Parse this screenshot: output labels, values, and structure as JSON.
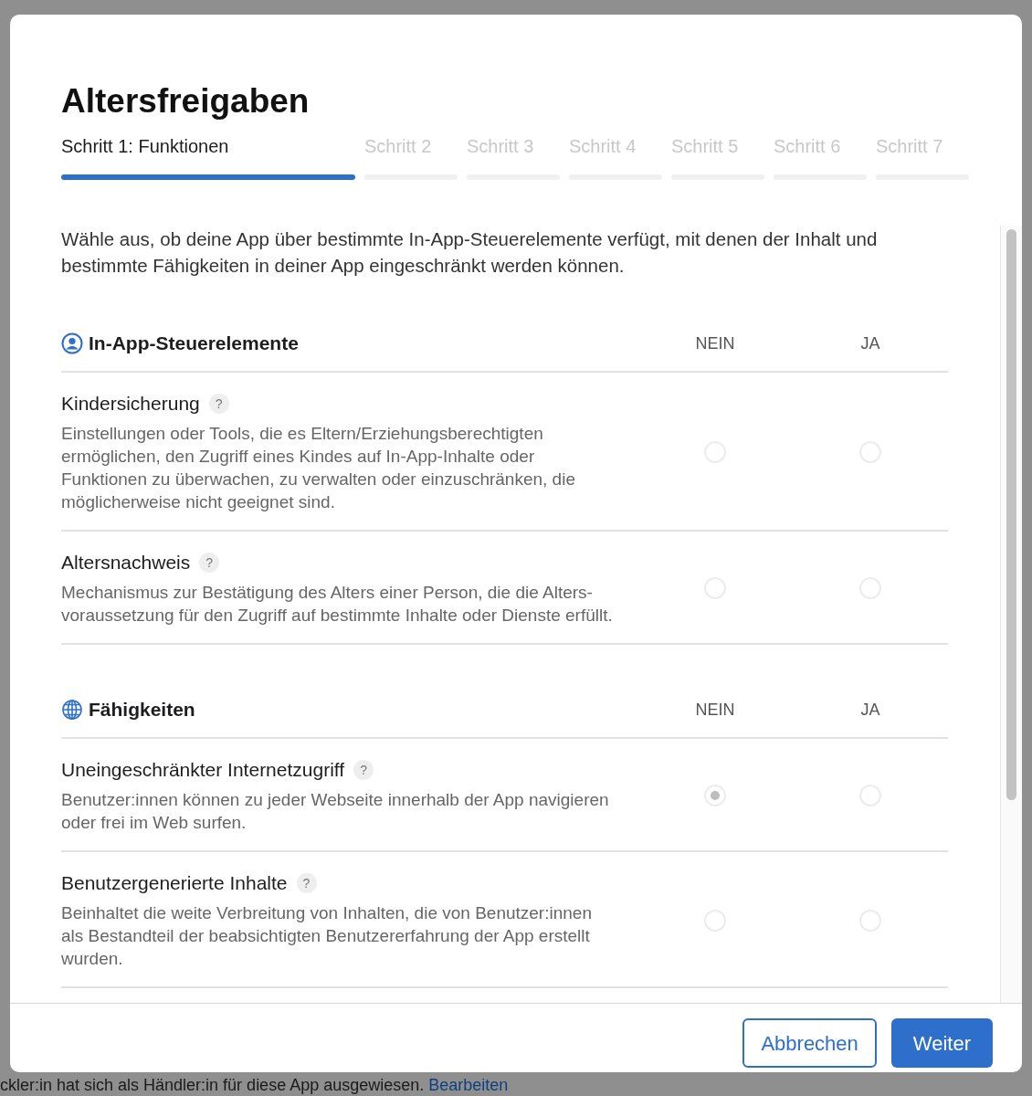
{
  "background": {
    "text": "ckler:in hat sich als Händler:in für diese App ausgewiesen.",
    "link": "Bearbeiten"
  },
  "dialog": {
    "title": "Altersfreigaben",
    "steps": [
      {
        "label": "Schritt 1: Funktionen",
        "selected": true
      },
      {
        "label": "Schritt 2",
        "selected": false
      },
      {
        "label": "Schritt 3",
        "selected": false
      },
      {
        "label": "Schritt 4",
        "selected": false
      },
      {
        "label": "Schritt 5",
        "selected": false
      },
      {
        "label": "Schritt 6",
        "selected": false
      },
      {
        "label": "Schritt 7",
        "selected": false
      }
    ],
    "intro": "Wähle aus, ob deine App über bestimmte In-App-Steuerelemente verfügt, mit denen der Inhalt und bestimmte Fähigkeiten in deiner App eingeschränkt werden können.",
    "sections": [
      {
        "kind": "person",
        "title": "In-App-Steuerelemente",
        "columns": [
          "NEIN",
          "JA"
        ],
        "rows": [
          {
            "title": "Kindersicherung",
            "help": "?",
            "description": "Einstellungen oder Tools, die es Eltern/Erziehungsberechtigten ermöglichen, den Zugriff eines Kindes auf In-App-Inhalte oder Funktionen zu überwachen, zu verwalten oder einzuschränken, die möglicherweise nicht geeignet sind.",
            "choices": [
              {
                "selected": false
              },
              {
                "selected": false
              }
            ]
          },
          {
            "title": "Altersnachweis",
            "help": "?",
            "description": "Mechanismus zur Bestätigung des Alters einer Person, die die Alters-voraussetzung für den Zugriff auf bestimmte Inhalte oder Dienste erfüllt.",
            "choices": [
              {
                "selected": false
              },
              {
                "selected": false
              }
            ]
          }
        ]
      },
      {
        "kind": "globe",
        "title": "Fähigkeiten",
        "columns": [
          "NEIN",
          "JA"
        ],
        "rows": [
          {
            "title": "Uneingeschränkter Internetzugriff",
            "help": "?",
            "description": "Benutzer:innen können zu jeder Webseite innerhalb der App navigieren oder frei im Web surfen.",
            "choices": [
              {
                "selected": true
              },
              {
                "selected": false
              }
            ]
          },
          {
            "title": "Benutzergenerierte Inhalte",
            "help": "?",
            "description": "Beinhaltet die weite Verbreitung von Inhalten, die von Benutzer:innen als Bestandteil der beabsichtigten Benutzererfahrung der App erstellt wurden.",
            "choices": [
              {
                "selected": false
              },
              {
                "selected": false
              }
            ]
          }
        ]
      }
    ],
    "buttons": [
      {
        "kind": "secondary",
        "label": "Abbrechen"
      },
      {
        "kind": "primary",
        "label": "Weiter"
      }
    ]
  }
}
